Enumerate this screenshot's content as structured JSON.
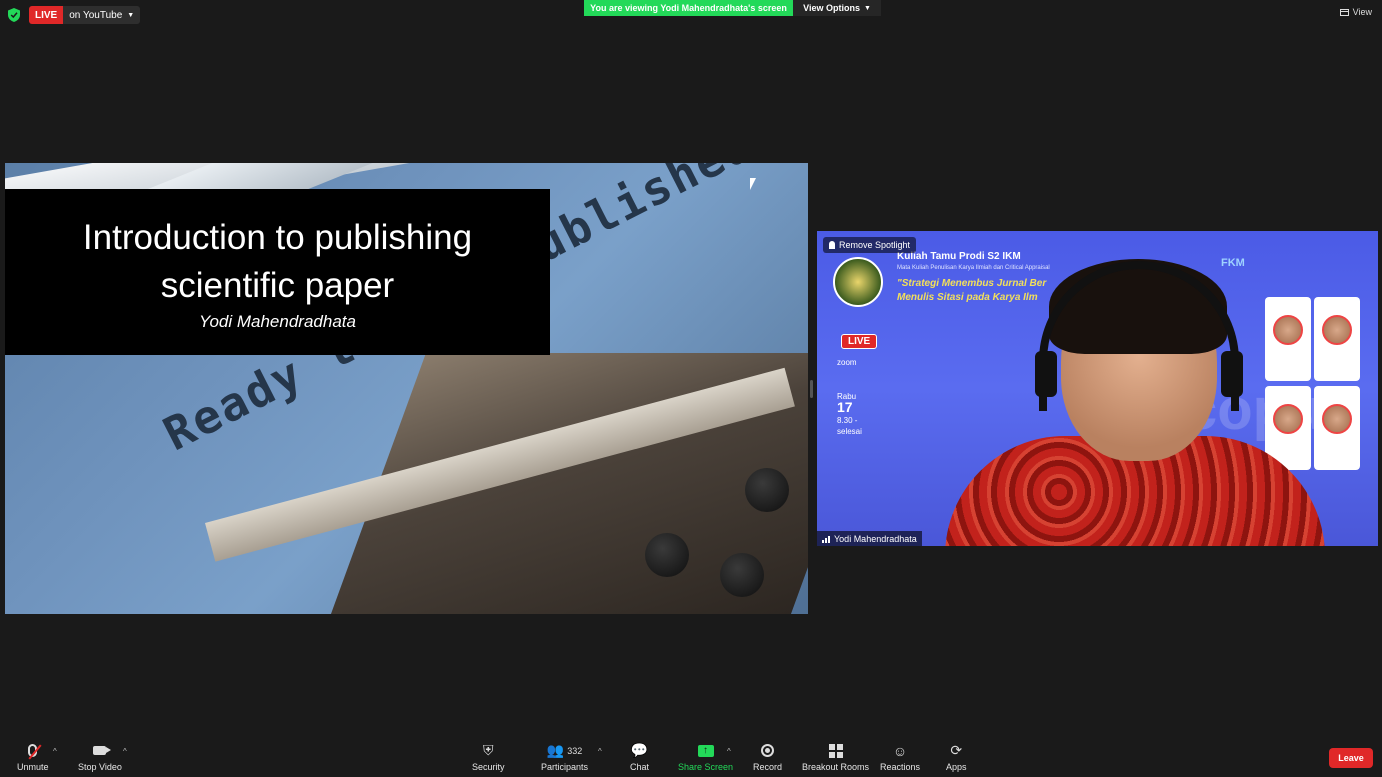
{
  "top_bar": {
    "live_label": "LIVE",
    "live_platform": "on YouTube",
    "viewing_banner": "You are viewing Yodi Mahendradhata's screen",
    "view_options_label": "View Options",
    "view_label": "View",
    "icons": [
      "shield-icon",
      "chevron-down-icon",
      "view-layout-icon"
    ]
  },
  "shared_screen": {
    "title_line1": "Introduction to publishing",
    "title_line2": "scientific paper",
    "author": "Yodi Mahendradhata",
    "typewriter_text": "Ready to get published"
  },
  "speaker": {
    "spotlight_label": "Remove Spotlight",
    "name": "Yodi Mahendradhata",
    "background": {
      "title": "Kuliah Tamu Prodi S2 IKM",
      "subtitle": "Mata Kuliah Penulisan Karya Ilmiah dan Critical Appraisal",
      "headline_1": "\"Strategi Menembus Jurnal Ber",
      "headline_2": "Menulis Sitasi pada Karya Ilm",
      "live": "LIVE",
      "zoom": "zoom",
      "day": "Rabu",
      "date": "17",
      "time_1": "8.30 -",
      "time_2": "selesai",
      "fkm": "FKM",
      "watermark": "copu"
    }
  },
  "toolbar": {
    "unmute": "Unmute",
    "stop_video": "Stop Video",
    "security": "Security",
    "participants": "Participants",
    "participant_count": "332",
    "chat": "Chat",
    "share_screen": "Share Screen",
    "record": "Record",
    "breakout_rooms": "Breakout Rooms",
    "reactions": "Reactions",
    "apps": "Apps",
    "leave": "Leave"
  },
  "colors": {
    "live_red": "#e02828",
    "share_green": "#23d959",
    "background": "#1a1a1a"
  }
}
